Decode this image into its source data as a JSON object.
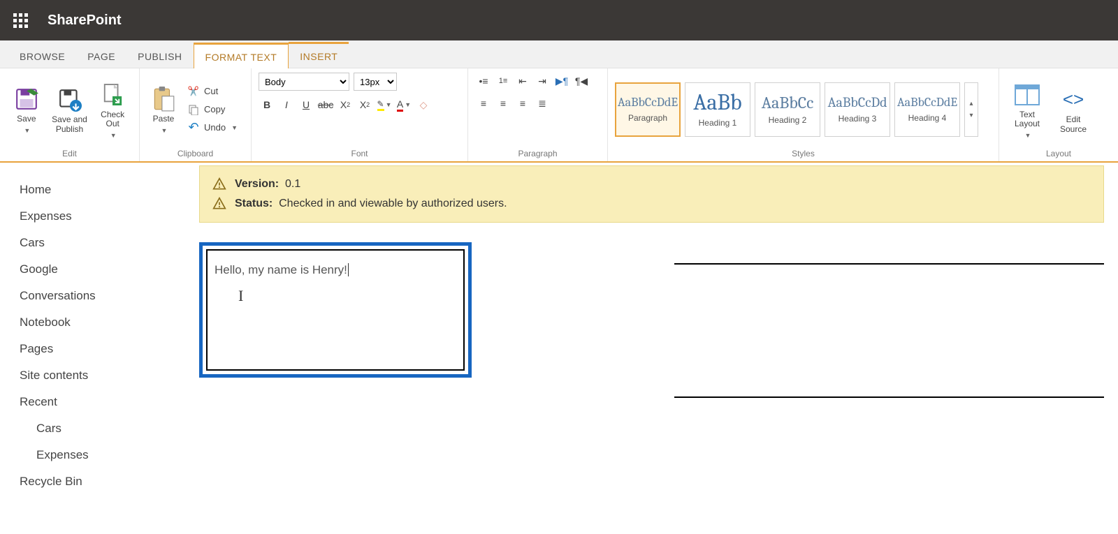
{
  "header": {
    "brand": "SharePoint"
  },
  "tabs": {
    "browse": "BROWSE",
    "page": "PAGE",
    "publish": "PUBLISH",
    "format_text": "FORMAT TEXT",
    "insert": "INSERT"
  },
  "ribbon": {
    "edit": {
      "label": "Edit",
      "save": "Save",
      "save_publish": "Save and Publish",
      "check_out": "Check Out"
    },
    "clipboard": {
      "label": "Clipboard",
      "paste": "Paste",
      "cut": "Cut",
      "copy": "Copy",
      "undo": "Undo"
    },
    "font": {
      "label": "Font",
      "family": "Body",
      "size": "13px"
    },
    "paragraph": {
      "label": "Paragraph"
    },
    "styles": {
      "label": "Styles",
      "items": [
        {
          "sample": "AaBbCcDdE",
          "name": "Paragraph",
          "cls": ""
        },
        {
          "sample": "AaBb",
          "name": "Heading 1",
          "cls": "h1"
        },
        {
          "sample": "AaBbCc",
          "name": "Heading 2",
          "cls": ""
        },
        {
          "sample": "AaBbCcDd",
          "name": "Heading 3",
          "cls": ""
        },
        {
          "sample": "AaBbCcDdE",
          "name": "Heading 4",
          "cls": ""
        }
      ]
    },
    "layout": {
      "label": "Layout",
      "text_layout": "Text Layout",
      "edit_source": "Edit Source"
    }
  },
  "leftnav": {
    "items": [
      "Home",
      "Expenses",
      "Cars",
      "Google",
      "Conversations",
      "Notebook",
      "Pages",
      "Site contents",
      "Recent"
    ],
    "recent_children": [
      "Cars",
      "Expenses"
    ],
    "recycle": "Recycle Bin"
  },
  "notice": {
    "version_label": "Version:",
    "version_value": "0.1",
    "status_label": "Status:",
    "status_value": "Checked in and viewable by authorized users."
  },
  "editor": {
    "text": "Hello, my name is Henry!"
  }
}
